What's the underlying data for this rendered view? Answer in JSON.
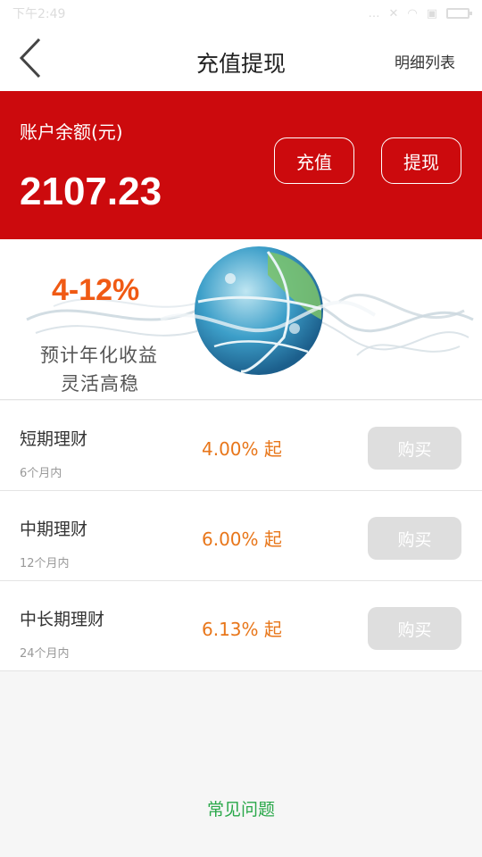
{
  "status_bar": {
    "time": "下午2:49"
  },
  "nav": {
    "title": "充值提现",
    "right_link": "明细列表"
  },
  "balance": {
    "label": "账户余额(元)",
    "amount": "2107.23",
    "recharge_label": "充值",
    "withdraw_label": "提现"
  },
  "banner": {
    "rate_range": "4-12%",
    "line1": "预计年化收益",
    "line2": "灵活高稳"
  },
  "products": [
    {
      "name": "短期理财",
      "term": "6个月内",
      "rate": "4.00% 起",
      "buy_label": "购买"
    },
    {
      "name": "中期理财",
      "term": "12个月内",
      "rate": "6.00% 起",
      "buy_label": "购买"
    },
    {
      "name": "中长期理财",
      "term": "24个月内",
      "rate": "6.13% 起",
      "buy_label": "购买"
    }
  ],
  "footer": {
    "faq_label": "常见问题"
  },
  "colors": {
    "brand_red": "#cc0a0d",
    "rate_orange": "#e8761a",
    "faq_green": "#2aa84a",
    "buy_disabled": "#dedede"
  }
}
